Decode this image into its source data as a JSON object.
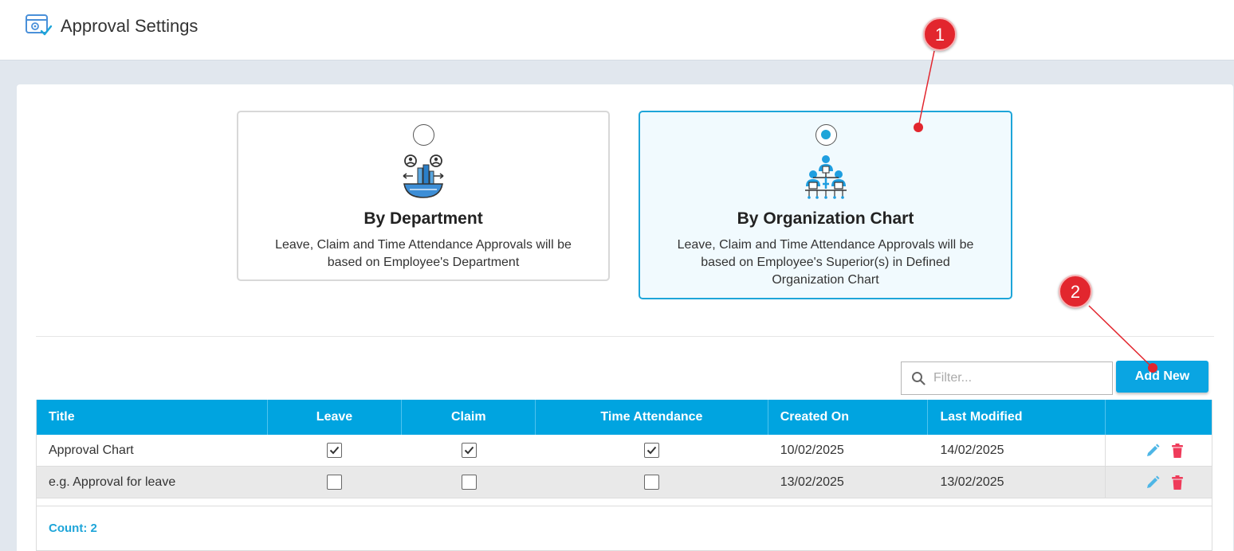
{
  "header": {
    "title": "Approval Settings",
    "icon": "settings-window-icon"
  },
  "options": [
    {
      "title": "By Department",
      "description": "Leave, Claim and Time Attendance Approvals will be based on Employee's Department",
      "selected": false,
      "icon": "department-icon"
    },
    {
      "title": "By Organization Chart",
      "description": "Leave, Claim and Time Attendance Approvals will be based on Employee's Superior(s) in Defined Organization Chart",
      "selected": true,
      "icon": "org-chart-icon"
    }
  ],
  "toolbar": {
    "filter_placeholder": "Filter...",
    "add_label": "Add New"
  },
  "table": {
    "columns": [
      "Title",
      "Leave",
      "Claim",
      "Time Attendance",
      "Created On",
      "Last Modified",
      ""
    ],
    "rows": [
      {
        "title": "Approval Chart",
        "leave": true,
        "claim": true,
        "time_attendance": true,
        "created_on": "10/02/2025",
        "last_modified": "14/02/2025"
      },
      {
        "title": "e.g. Approval for leave",
        "leave": false,
        "claim": false,
        "time_attendance": false,
        "created_on": "13/02/2025",
        "last_modified": "13/02/2025"
      }
    ],
    "count_label": "Count: 2"
  },
  "callouts": [
    "1",
    "2"
  ],
  "colors": {
    "accent": "#00a4e0",
    "callout": "#e2262e",
    "delete": "#ef3b5a",
    "edit": "#4eb6e6"
  }
}
